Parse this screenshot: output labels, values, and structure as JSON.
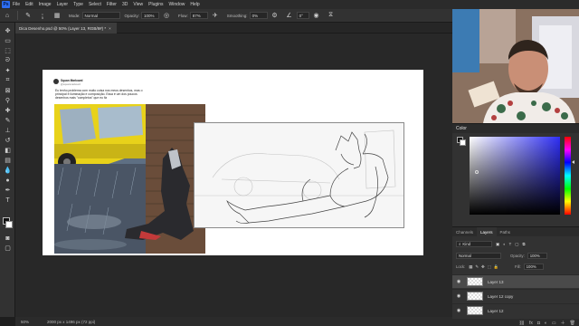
{
  "menu": {
    "app_icon": "Ps",
    "items": [
      "File",
      "Edit",
      "Image",
      "Layer",
      "Type",
      "Select",
      "Filter",
      "3D",
      "View",
      "Plugins",
      "Window",
      "Help"
    ]
  },
  "options_bar": {
    "brush_size": "5",
    "mode_label": "Mode:",
    "mode_value": "Normal",
    "opacity_label": "Opacity:",
    "opacity_value": "100%",
    "flow_label": "Flow:",
    "flow_value": "87%",
    "smoothing_label": "Smoothing:",
    "smoothing_value": "0%",
    "angle_value": "0°"
  },
  "document_tab": {
    "title": "Dica Desenho.psd @ 50% (Layer 13, RGB/8#) *",
    "close_glyph": "×"
  },
  "tweet": {
    "name": "Squan Markowd",
    "handle": "@squanmarkowd",
    "body": "Eu tenho problema com muito coisa nos meus desenhos, mas o principal é iluminação e composição. Essa é um dos poucos desenhos mais \"completos\" que eu fiz"
  },
  "status_bar": {
    "zoom": "50%",
    "doc_info": "2000 px x 1496 px (72 ppi)"
  },
  "color_panel": {
    "title": "Color",
    "picker_hue_color": "#2f2ff5"
  },
  "layers_panel": {
    "tabs": [
      "Channels",
      "Layers",
      "Paths"
    ],
    "active_tab": "Layers",
    "filter_kind": "Kind",
    "blend_mode": "Normal",
    "opacity_label": "Opacity:",
    "opacity_value": "100%",
    "lock_label": "Lock:",
    "fill_label": "Fill:",
    "fill_value": "100%",
    "layers": [
      {
        "name": "Layer 13",
        "selected": true
      },
      {
        "name": "Layer 12 copy",
        "selected": false
      },
      {
        "name": "Layer 12",
        "selected": false
      }
    ]
  },
  "icons": {
    "tools": [
      "move-icon",
      "artboard-icon",
      "marquee-icon",
      "lasso-icon",
      "quick-select-icon",
      "crop-icon",
      "frame-icon",
      "eyedropper-icon",
      "healing-icon",
      "brush-icon",
      "stamp-icon",
      "history-brush-icon",
      "eraser-icon",
      "gradient-icon",
      "blur-icon",
      "dodge-icon",
      "pen-icon",
      "type-icon",
      "path-select-icon",
      "rectangle-icon",
      "hand-icon",
      "zoom-icon"
    ]
  },
  "colors": {
    "ui_dark": "#323232",
    "selected_layer": "#4a4a4a",
    "taxi_yellow": "#e8d21a"
  }
}
